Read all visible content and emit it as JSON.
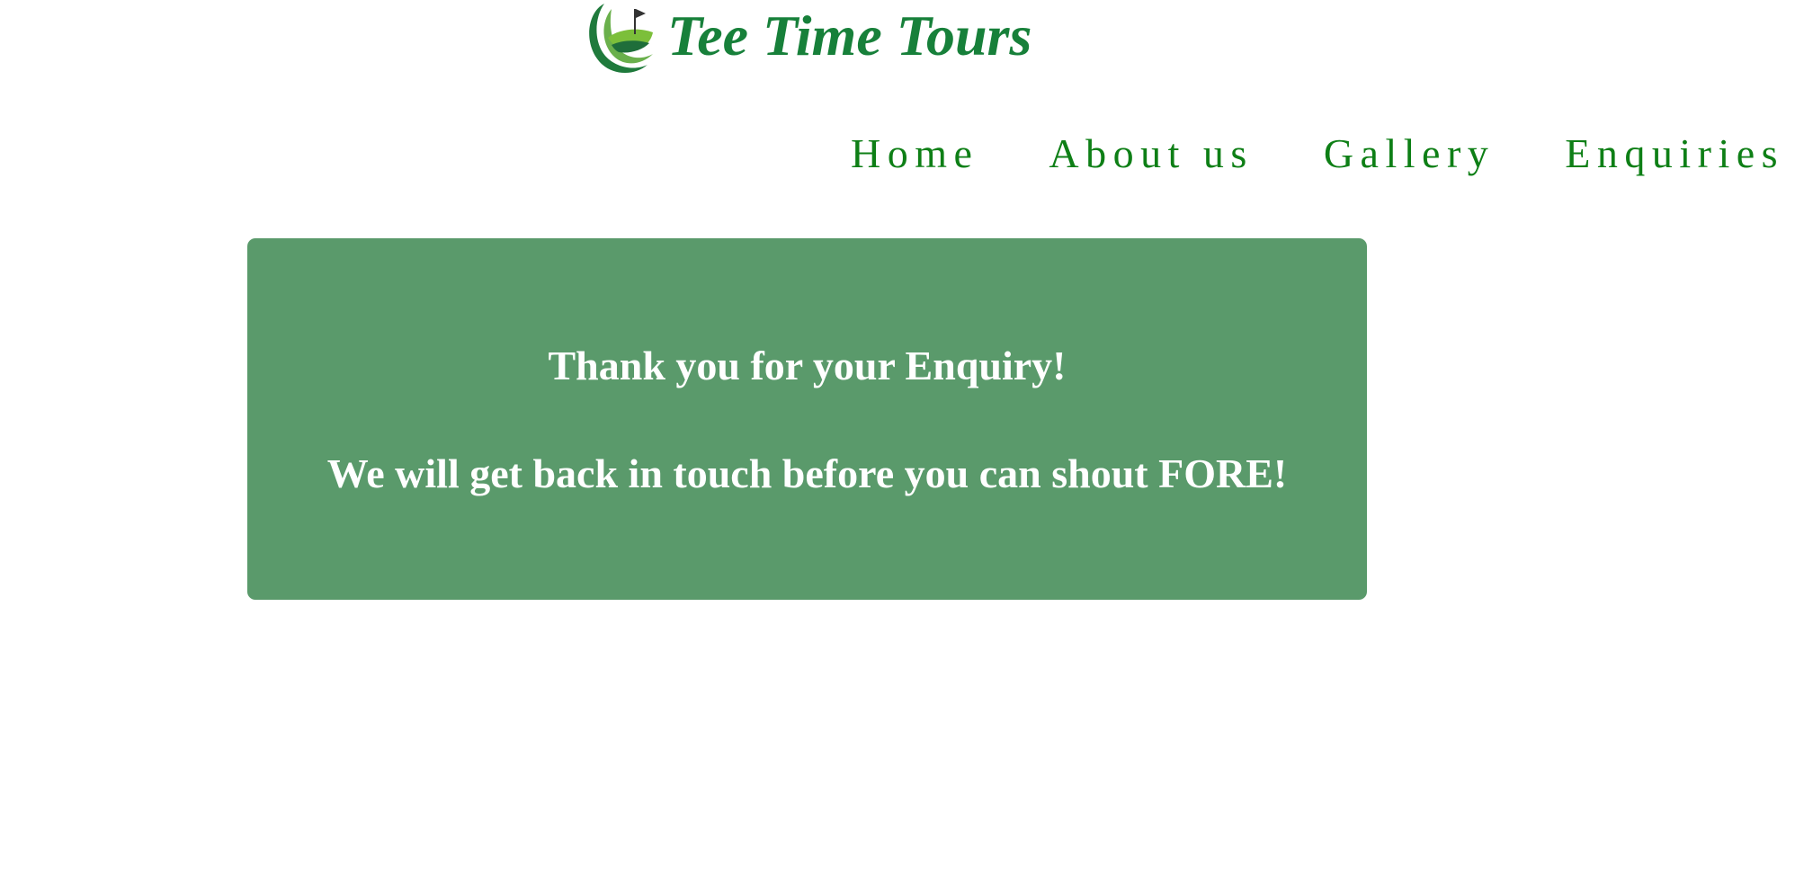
{
  "site": {
    "brand_name": "Tee Time Tours",
    "logo_icon": "golf-flag-logo-icon",
    "brand_color": "#17803a"
  },
  "nav": {
    "items": [
      {
        "label": "Home"
      },
      {
        "label": "About us"
      },
      {
        "label": "Gallery"
      },
      {
        "label": "Enquiries"
      }
    ],
    "color": "#0e7f16"
  },
  "confirmation": {
    "heading": "Thank you for your Enquiry!",
    "message": "We will get back in touch before you can shout FORE!",
    "background_color": "#5a9a6b",
    "text_color": "#ffffff"
  }
}
